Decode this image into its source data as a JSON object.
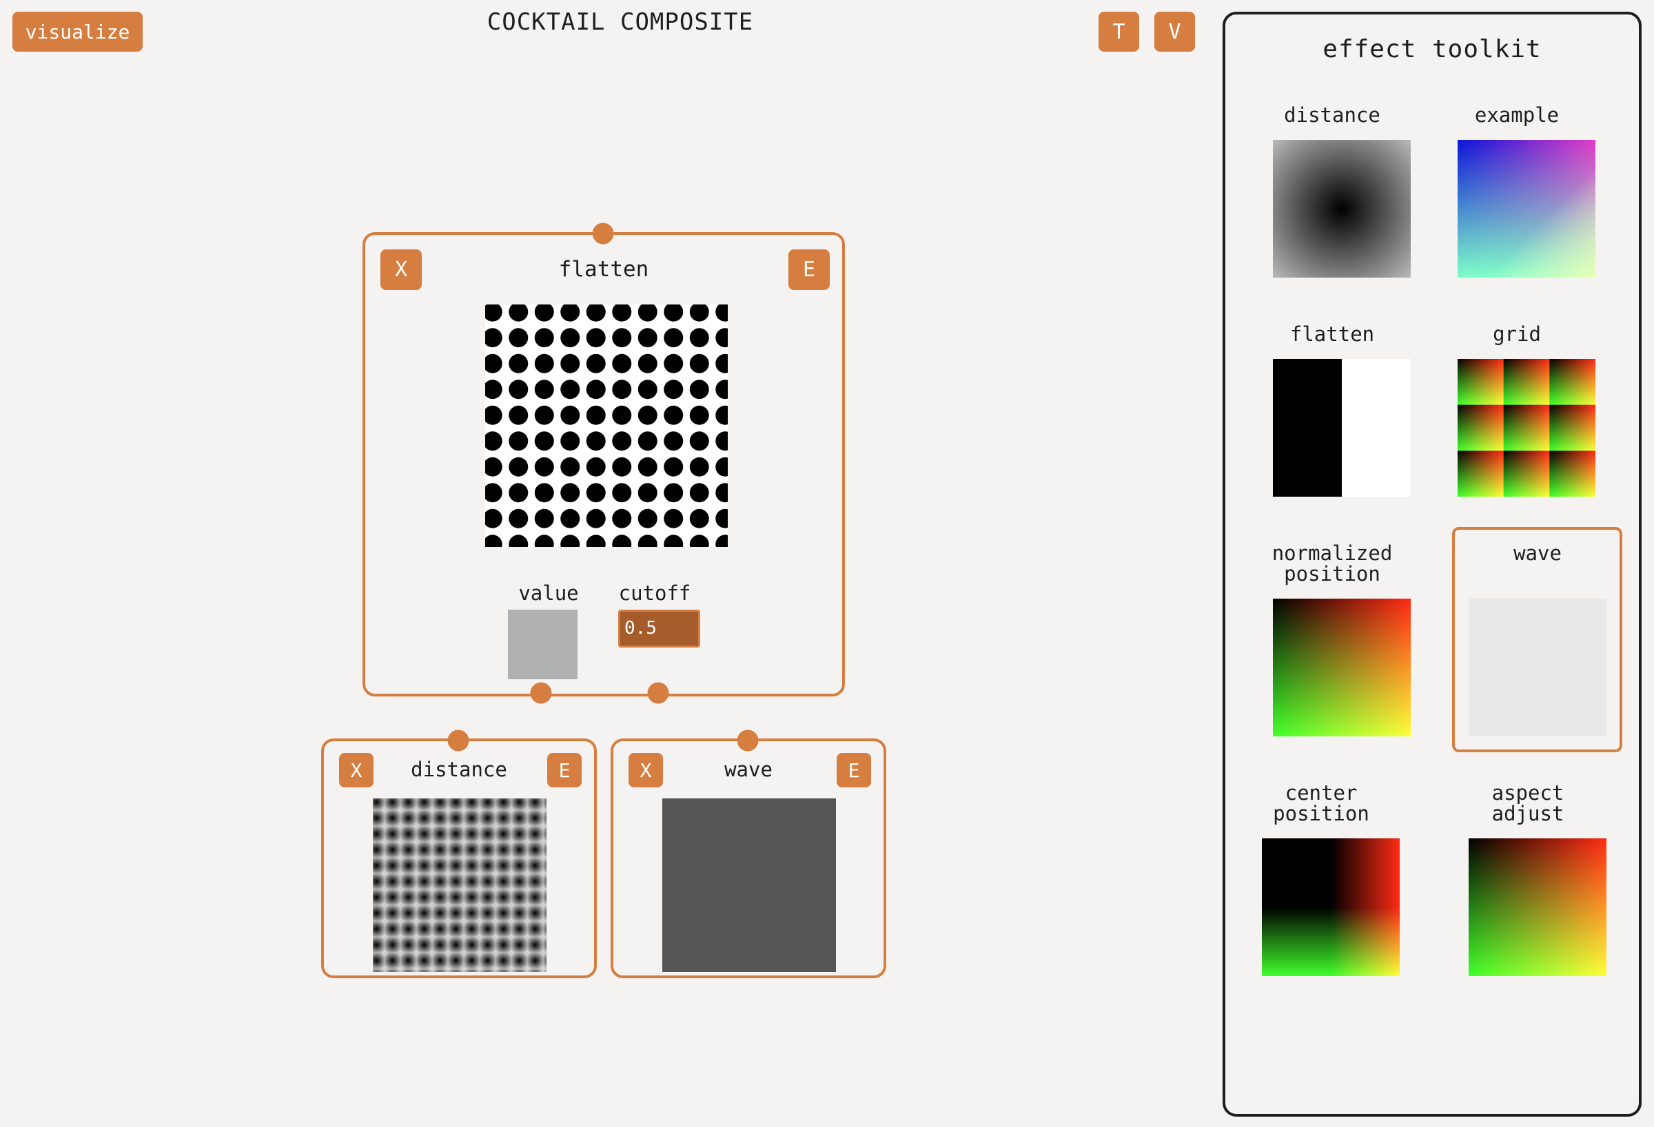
{
  "header": {
    "visualize_label": "visualize",
    "title": "COCKTAIL COMPOSITE",
    "t_label": "T",
    "v_label": "V"
  },
  "nodes": {
    "flatten": {
      "title": "flatten",
      "close_label": "X",
      "edit_label": "E",
      "value_label": "value",
      "cutoff_label": "cutoff",
      "cutoff_value": "0.5"
    },
    "distance": {
      "title": "distance",
      "close_label": "X",
      "edit_label": "E"
    },
    "wave": {
      "title": "wave",
      "close_label": "X",
      "edit_label": "E"
    }
  },
  "toolkit": {
    "title": "effect toolkit",
    "items": [
      {
        "label": "distance"
      },
      {
        "label": "example"
      },
      {
        "label": "flatten"
      },
      {
        "label": "grid"
      },
      {
        "label_line1": "normalized",
        "label_line2": "position"
      },
      {
        "label": "wave"
      },
      {
        "label_line1": "center",
        "label_line2": "position"
      },
      {
        "label_line1": "aspect",
        "label_line2": "adjust"
      }
    ],
    "selected": "wave"
  },
  "colors": {
    "accent": "#d57e40",
    "background": "#f5f3f1",
    "cutoff_field": "#a65b2b",
    "value_swatch": "#b0b1b3",
    "wave_preview": "#555555"
  }
}
